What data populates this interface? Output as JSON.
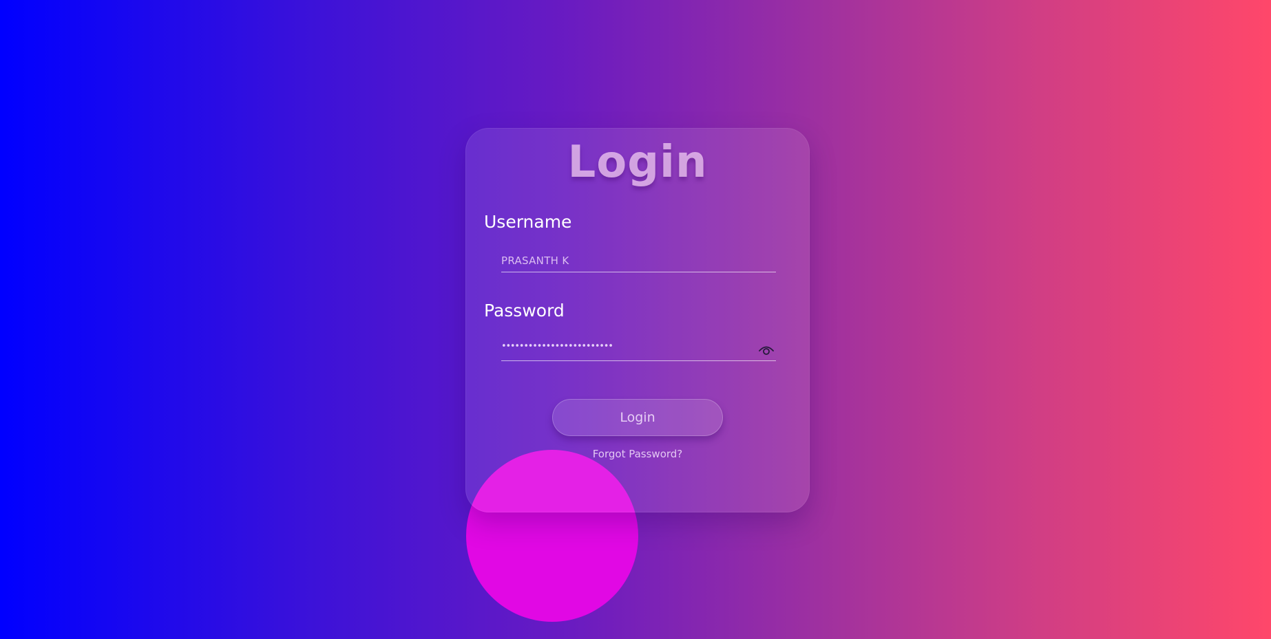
{
  "login_form": {
    "title": "Login",
    "username_label": "Username",
    "username_value": "PRASANTH K",
    "password_label": "Password",
    "password_masked": "•••••••••••••••••••••••••",
    "show_password_icon": "eye-icon",
    "submit_label": "Login",
    "forgot_password_label": "Forgot Password?"
  },
  "theme": {
    "background_gradient": [
      "#0000ff",
      "#6a1bc1",
      "#ff476a"
    ],
    "decor_circle_color": "#e108e4",
    "text_color": "#ffffff"
  }
}
